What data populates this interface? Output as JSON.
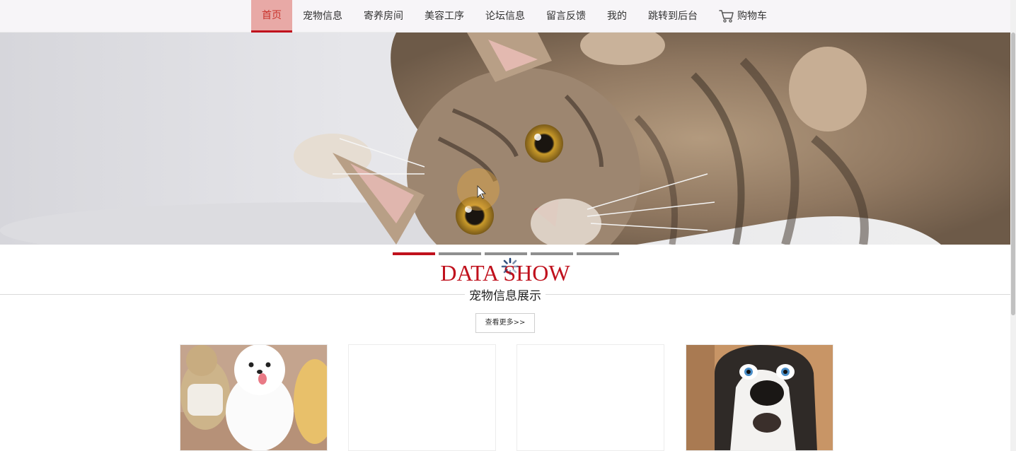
{
  "nav": {
    "items": [
      {
        "label": "首页",
        "active": true
      },
      {
        "label": "宠物信息"
      },
      {
        "label": "寄养房间"
      },
      {
        "label": "美容工序"
      },
      {
        "label": "论坛信息"
      },
      {
        "label": "留言反馈"
      },
      {
        "label": "我的"
      },
      {
        "label": "跳转到后台"
      }
    ],
    "cart_label": "购物车",
    "cart_icon": "shopping-cart-icon",
    "accent_color": "#c0111d"
  },
  "banner": {
    "slide_count": 5,
    "active_slide": 1
  },
  "section": {
    "title_en": "DATA SHOW",
    "title_cn": "宠物信息展示",
    "more_label": "查看更多>>"
  },
  "products": [
    {
      "image": "white-pomeranian-with-toys"
    },
    {
      "image": "blank"
    },
    {
      "image": "blank"
    },
    {
      "image": "surprised-husky"
    }
  ]
}
